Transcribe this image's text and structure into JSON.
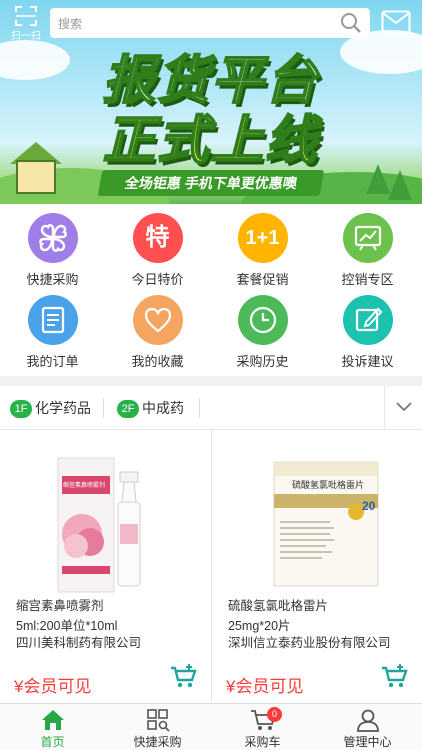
{
  "top_bar": {
    "scan_label": "扫一扫",
    "search_placeholder": "搜索",
    "icons": [
      "scan-icon",
      "search-icon",
      "message-icon"
    ]
  },
  "banner": {
    "headline_line1": "报货平台",
    "headline_line2": "正式上线",
    "slogan": "全场钜惠 手机下单更优惠噢"
  },
  "quick_menu": [
    {
      "label": "快捷采购",
      "icon": "clover-icon",
      "color": "#a07ee8"
    },
    {
      "label": "今日特价",
      "icon": "special-price-icon",
      "glyph": "特",
      "color": "#ff4f4f"
    },
    {
      "label": "套餐促销",
      "icon": "bundle-icon",
      "glyph": "1+1",
      "color": "#ffb400"
    },
    {
      "label": "控销专区",
      "icon": "chart-board-icon",
      "color": "#6cc24a"
    },
    {
      "label": "我的订单",
      "icon": "order-list-icon",
      "color": "#4aa3e8"
    },
    {
      "label": "我的收藏",
      "icon": "heart-icon",
      "color": "#f5a560"
    },
    {
      "label": "采购历史",
      "icon": "clock-icon",
      "color": "#4cba58"
    },
    {
      "label": "投诉建议",
      "icon": "edit-note-icon",
      "color": "#1dc3ae"
    }
  ],
  "category_tabs": [
    {
      "badge": "1F",
      "label": "化学药品"
    },
    {
      "badge": "2F",
      "label": "中成药"
    }
  ],
  "products": [
    {
      "name": "缩宫素鼻喷雾剂",
      "spec": "5ml:200单位*10ml",
      "maker": "四川美科制药有限公司",
      "price": "¥会员可见",
      "box_label": "缩宫素鼻喷雾剂"
    },
    {
      "name": "硫酸氢氯吡格雷片",
      "spec": "25mg*20片",
      "maker": "深圳信立泰药业股份有限公司",
      "price": "¥会员可见",
      "box_label": "硫酸氢氯吡格雷片",
      "box_label_en": "Clopidogrel Bisulfate Tablets",
      "box_count": "20"
    }
  ],
  "bottom_nav": [
    {
      "label": "首页",
      "icon": "home-icon",
      "active": true
    },
    {
      "label": "快捷采购",
      "icon": "grid-search-icon",
      "active": false
    },
    {
      "label": "采购车",
      "icon": "cart-icon",
      "badge": "0",
      "active": false
    },
    {
      "label": "管理中心",
      "icon": "user-icon",
      "active": false
    }
  ],
  "colors": {
    "accent": "#27b24a",
    "price": "#ff3b3b"
  }
}
